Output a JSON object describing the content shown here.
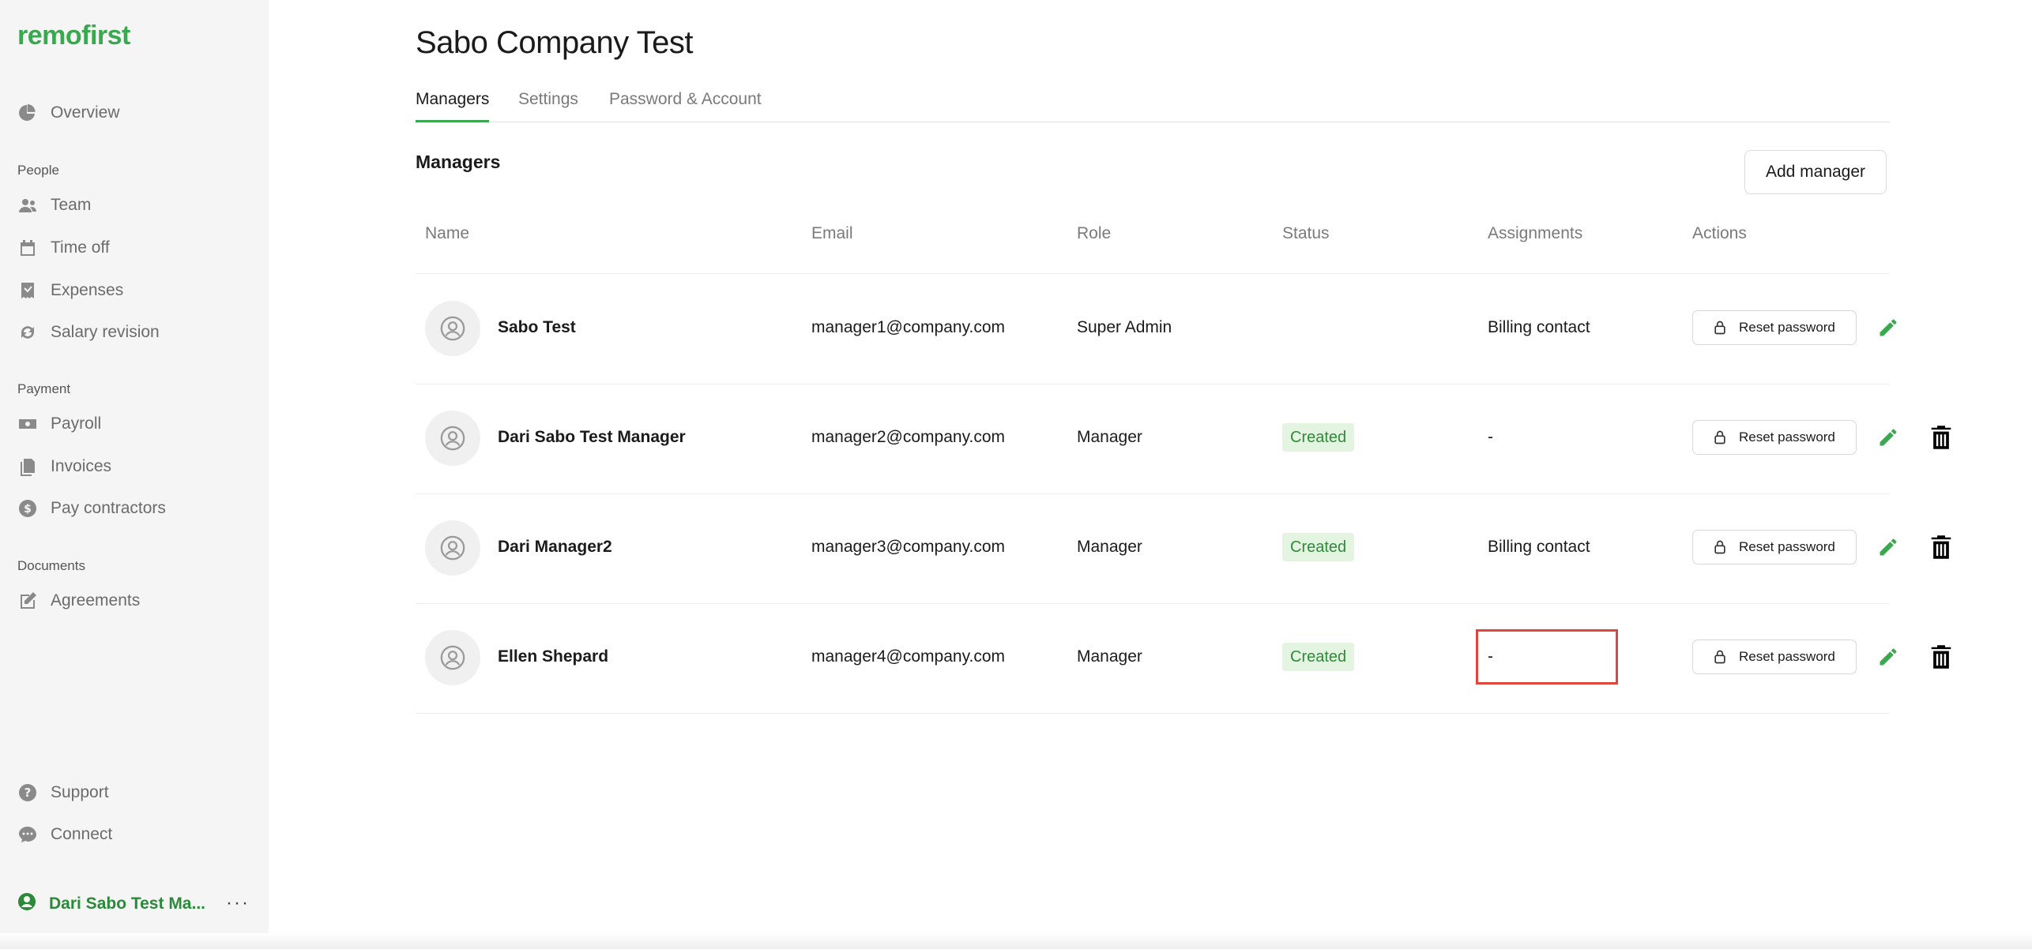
{
  "brand": {
    "logo_text": "remofirst",
    "accent": "#3aa84f"
  },
  "sidebar": {
    "overview": {
      "label": "Overview",
      "icon": "pie-chart-icon"
    },
    "sections": {
      "people": "People",
      "payment": "Payment",
      "documents": "Documents"
    },
    "people_items": [
      {
        "label": "Team",
        "icon": "team-icon"
      },
      {
        "label": "Time off",
        "icon": "calendar-icon"
      },
      {
        "label": "Expenses",
        "icon": "receipt-icon"
      },
      {
        "label": "Salary revision",
        "icon": "refresh-icon"
      }
    ],
    "payment_items": [
      {
        "label": "Payroll",
        "icon": "banknote-icon"
      },
      {
        "label": "Invoices",
        "icon": "documents-icon"
      },
      {
        "label": "Pay contractors",
        "icon": "dollar-icon"
      }
    ],
    "document_items": [
      {
        "label": "Agreements",
        "icon": "edit-document-icon"
      }
    ],
    "footer_items": [
      {
        "label": "Support",
        "icon": "help-icon"
      },
      {
        "label": "Connect",
        "icon": "chat-icon"
      }
    ],
    "user": {
      "label": "Dari Sabo Test Ma...",
      "more": "···"
    }
  },
  "page": {
    "title": "Sabo Company Test",
    "tabs": [
      "Managers",
      "Settings",
      "Password & Account"
    ],
    "active_tab": "Managers",
    "section_title": "Managers",
    "add_button": "Add manager"
  },
  "table": {
    "columns": [
      "Name",
      "Email",
      "Role",
      "Status",
      "Assignments",
      "Actions"
    ],
    "reset_label": "Reset password",
    "rows": [
      {
        "name": "Sabo Test",
        "email": "manager1@company.com",
        "role": "Super Admin",
        "status": "",
        "assignments": "Billing contact"
      },
      {
        "name": "Dari Sabo Test Manager",
        "email": "manager2@company.com",
        "role": "Manager",
        "status": "Created",
        "assignments": "-"
      },
      {
        "name": "Dari Manager2",
        "email": "manager3@company.com",
        "role": "Manager",
        "status": "Created",
        "assignments": "Billing contact"
      },
      {
        "name": "Ellen Shepard",
        "email": "manager4@company.com",
        "role": "Manager",
        "status": "Created",
        "assignments": "-"
      }
    ]
  },
  "colors": {
    "status_bg": "#e3f4e1",
    "status_text": "#2f8a3a",
    "highlight": "#e0473a"
  }
}
